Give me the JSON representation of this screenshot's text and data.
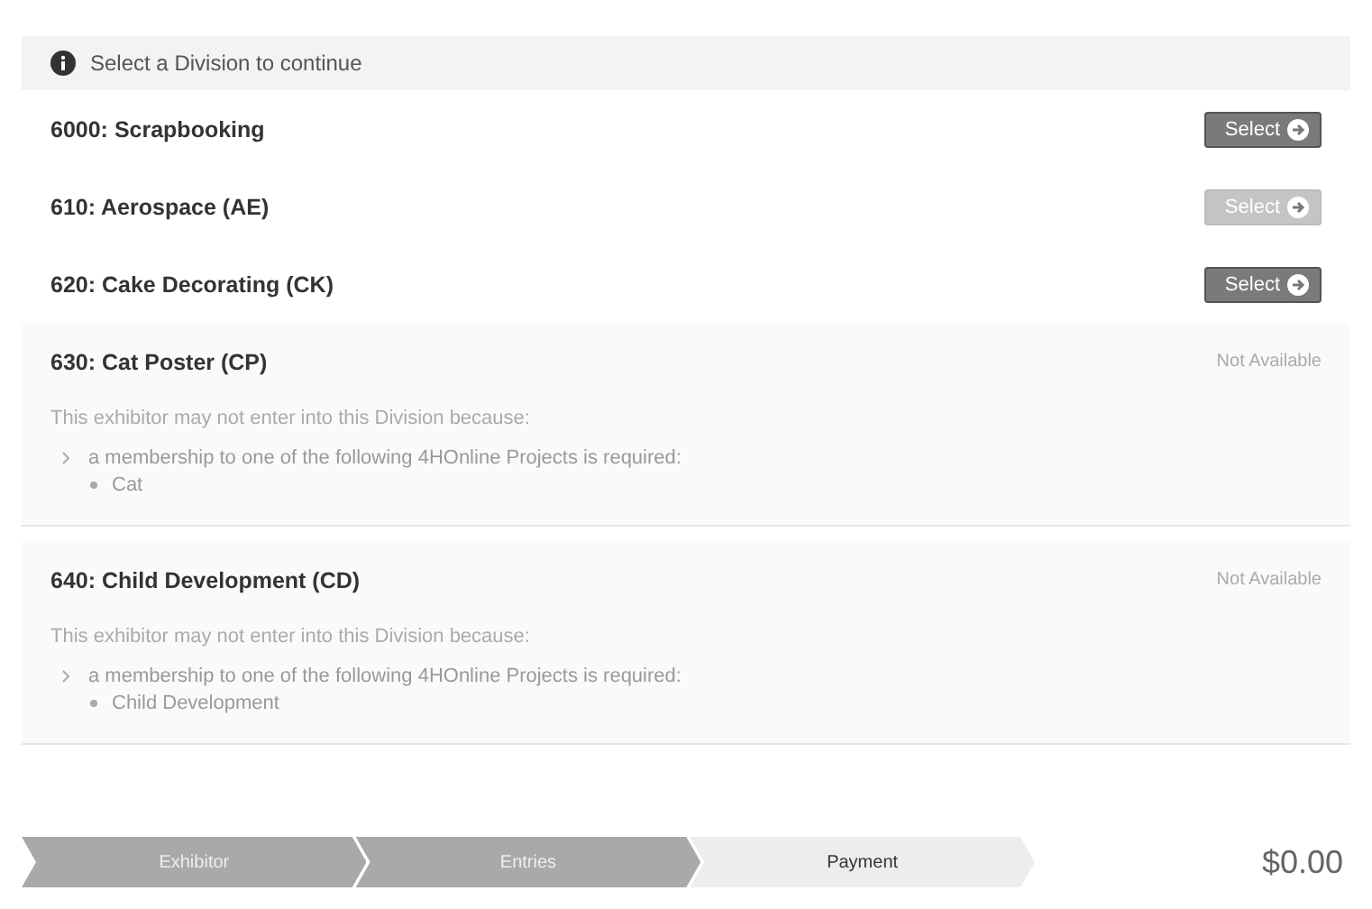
{
  "header": {
    "message": "Select a Division to continue"
  },
  "divisions": [
    {
      "kind": "selectable",
      "name": "6000: Scrapbooking",
      "button": "Select",
      "disabled": false
    },
    {
      "kind": "selectable",
      "name": "610: Aerospace (AE)",
      "button": "Select",
      "disabled": true
    },
    {
      "kind": "selectable",
      "name": "620: Cake Decorating (CK)",
      "button": "Select",
      "disabled": false
    },
    {
      "kind": "unavailable",
      "name": "630: Cat Poster (CP)",
      "status": "Not Available",
      "reason": "This exhibitor may not enter into this Division because:",
      "requirement": "a membership to one of the following 4HOnline Projects is required:",
      "projects": [
        "Cat"
      ]
    },
    {
      "kind": "unavailable",
      "name": "640: Child Development (CD)",
      "status": "Not Available",
      "reason": "This exhibitor may not enter into this Division because:",
      "requirement": "a membership to one of the following 4HOnline Projects is required:",
      "projects": [
        "Child Development"
      ]
    }
  ],
  "steps": [
    {
      "label": "Exhibitor",
      "selected": false
    },
    {
      "label": "Entries",
      "selected": false
    },
    {
      "label": "Payment",
      "selected": true
    }
  ],
  "total": "$0.00"
}
